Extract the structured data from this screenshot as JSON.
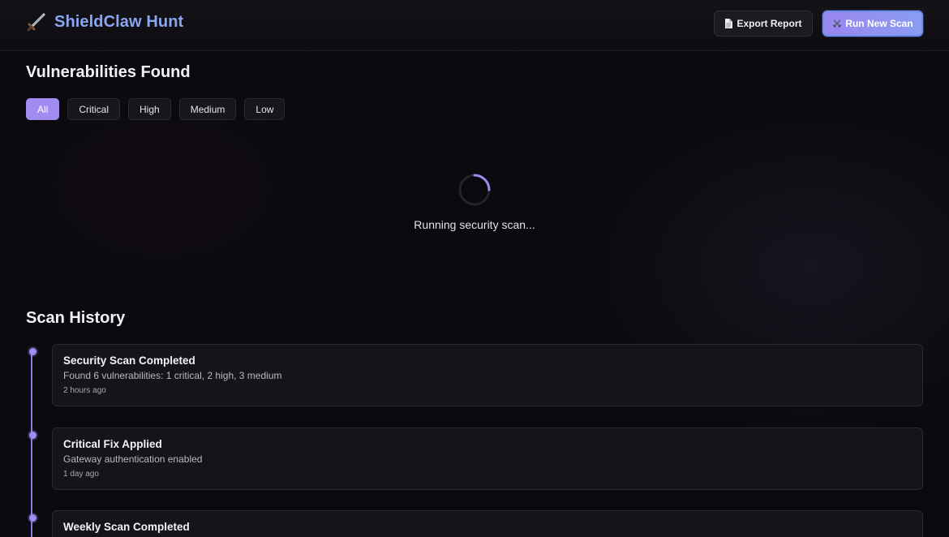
{
  "header": {
    "app_title": "ShieldClaw Hunt",
    "logo_icon": "dagger-icon",
    "export_label": "Export Report",
    "export_icon": "document-icon",
    "scan_label": "Run New Scan",
    "scan_icon": "crossed-swords-icon"
  },
  "vulnerabilities": {
    "title": "Vulnerabilities Found",
    "filters": [
      {
        "label": "All",
        "active": true
      },
      {
        "label": "Critical",
        "active": false
      },
      {
        "label": "High",
        "active": false
      },
      {
        "label": "Medium",
        "active": false
      },
      {
        "label": "Low",
        "active": false
      }
    ],
    "loading_text": "Running security scan..."
  },
  "history": {
    "title": "Scan History",
    "items": [
      {
        "title": "Security Scan Completed",
        "description": "Found 6 vulnerabilities: 1 critical, 2 high, 3 medium",
        "time": "2 hours ago"
      },
      {
        "title": "Critical Fix Applied",
        "description": "Gateway authentication enabled",
        "time": "1 day ago"
      },
      {
        "title": "Weekly Scan Completed",
        "description": "",
        "time": ""
      }
    ]
  },
  "colors": {
    "accent": "#a08bf0",
    "brand_text": "#8aa6f2",
    "background": "#0a090e"
  }
}
